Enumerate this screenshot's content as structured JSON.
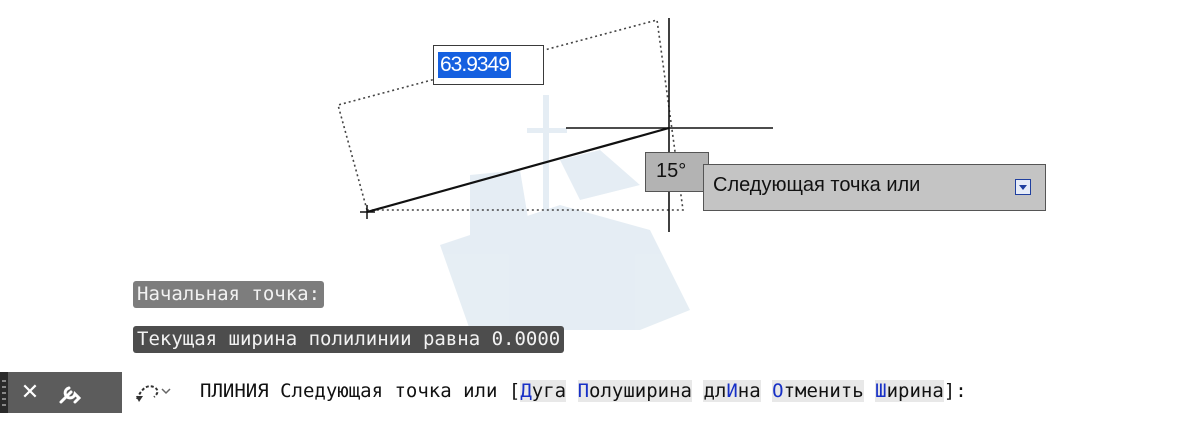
{
  "drawing": {
    "dynamic_input_value": "63.9349",
    "angle_value": "15°",
    "tooltip_prompt": "Следующая точка или"
  },
  "history": [
    "Начальная точка:",
    "Текущая ширина полилинии равна 0.0000"
  ],
  "command_line": {
    "command_name": "ПЛИНИЯ",
    "prompt": "Следующая точка или",
    "open_bracket": "[",
    "close_bracket": "]:",
    "options": [
      {
        "pre": "",
        "key": "Д",
        "post": "уга"
      },
      {
        "pre": "",
        "key": "П",
        "post": "олуширина"
      },
      {
        "pre": "дл",
        "key": "И",
        "post": "на"
      },
      {
        "pre": "",
        "key": "О",
        "post": "тменить"
      },
      {
        "pre": "",
        "key": "Ш",
        "post": "ирина"
      }
    ]
  },
  "icons": {
    "close": "close-icon",
    "customize": "wrench-icon",
    "recent_commands": "recent-commands-icon",
    "tooltip_dropdown": "dropdown-arrow-icon"
  },
  "colors": {
    "selection": "#1560e0",
    "option_key": "#1730c6",
    "toolbar": "#5c5c5c"
  }
}
